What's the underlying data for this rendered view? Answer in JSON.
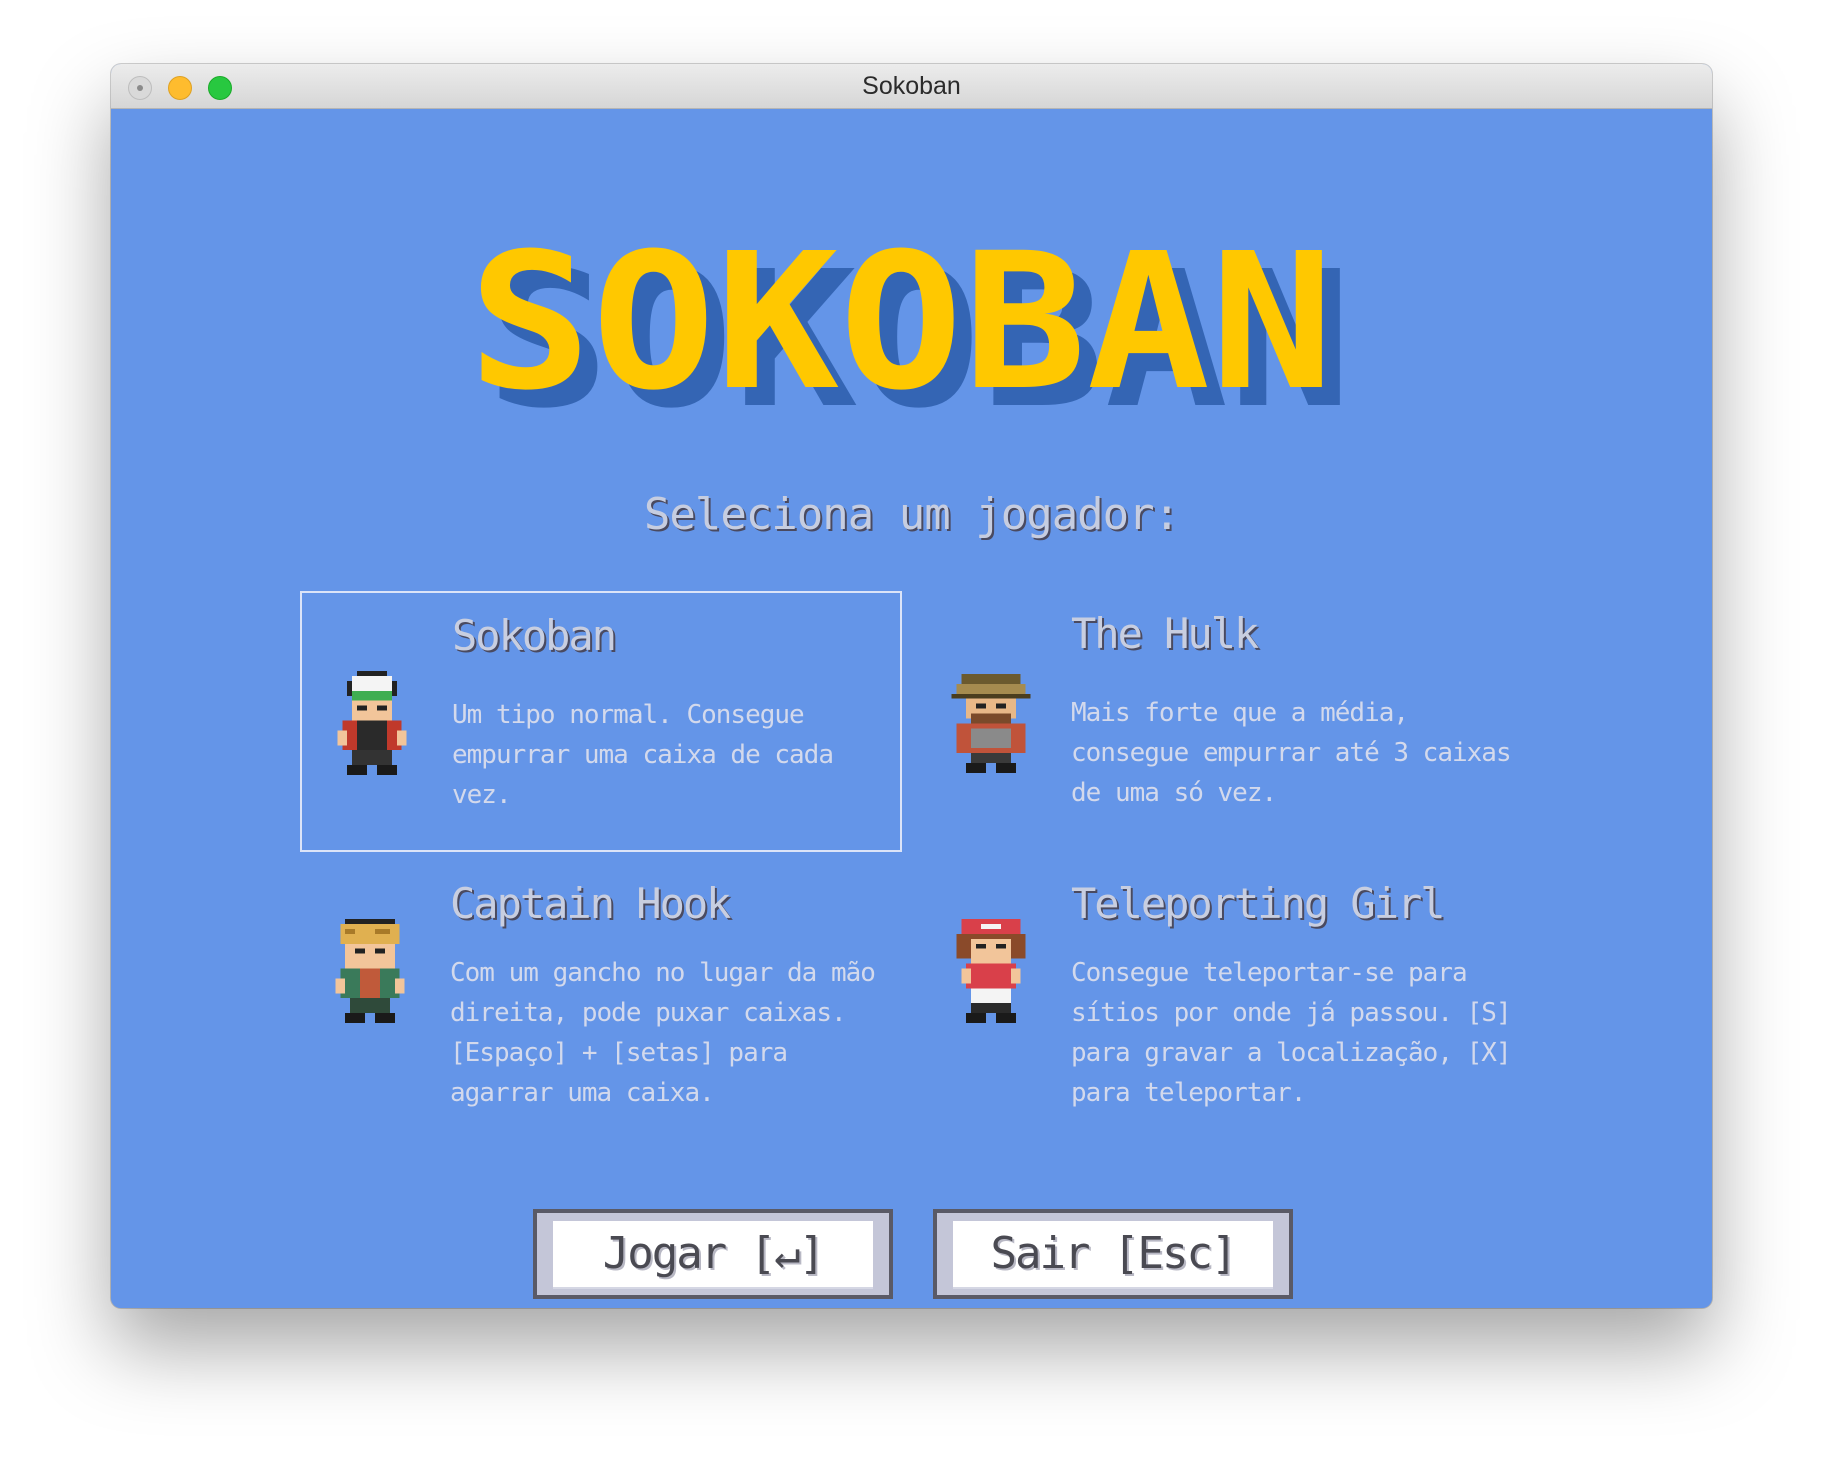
{
  "window": {
    "title": "Sokoban"
  },
  "logo": {
    "text": "SOKOBAN",
    "fill_color": "#ffc800",
    "shadow_color": "#3465b4"
  },
  "screen": {
    "prompt": "Seleciona um jogador:"
  },
  "players": [
    {
      "name": "Sokoban",
      "description": "Um tipo normal. Consegue empurrar uma caixa de cada vez.",
      "selected": true,
      "sprite": "boy-trainer-sprite"
    },
    {
      "name": "The Hulk",
      "description": "Mais forte que a média, consegue empurrar até 3 caixas de uma só vez.",
      "selected": false,
      "sprite": "hiker-sprite"
    },
    {
      "name": "Captain Hook",
      "description": "Com um gancho no lugar da mão direita, pode puxar caixas. [Espaço] + [setas] para agarrar uma caixa.",
      "selected": false,
      "sprite": "blond-trainer-sprite"
    },
    {
      "name": "Teleporting Girl",
      "description": "Consegue teleportar-se para sítios por onde já passou. [S] para gravar a localização, [X] para teleportar.",
      "selected": false,
      "sprite": "girl-trainer-sprite"
    }
  ],
  "buttons": {
    "play_label": "Jogar [↵]",
    "quit_label": "Sair [Esc]"
  },
  "colors": {
    "background": "#6495e8",
    "text": "#d3d9ec",
    "selection_border": "#dbe4f8"
  }
}
